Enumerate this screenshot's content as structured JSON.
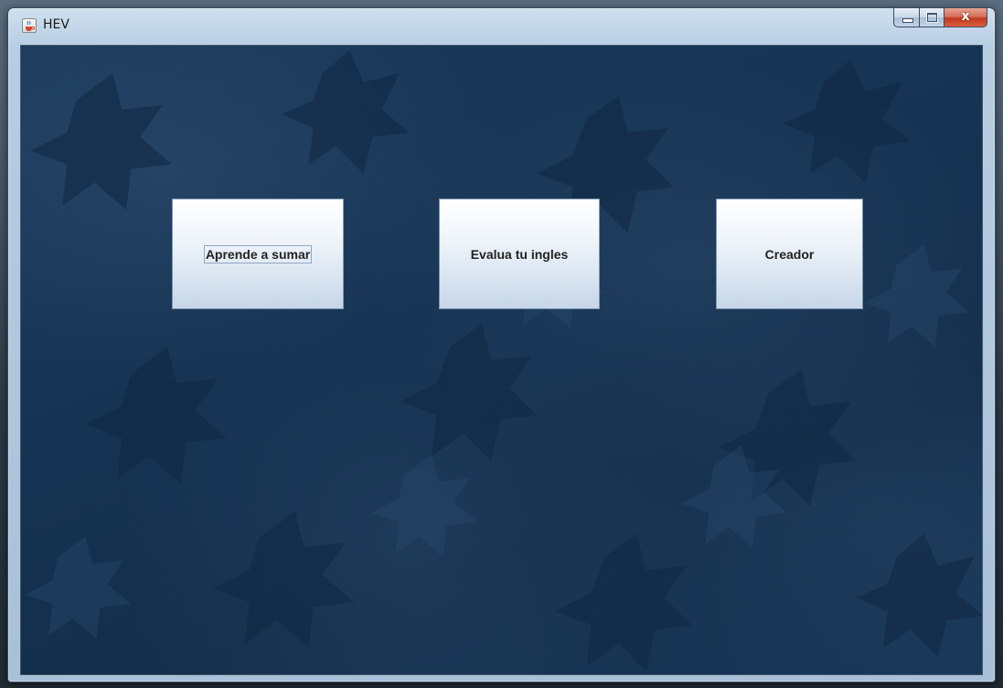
{
  "window": {
    "title": "HEV",
    "icon": "java-cup-icon",
    "controls": {
      "minimize": "minimize-icon",
      "maximize": "maximize-icon",
      "close_glyph": "x"
    }
  },
  "main": {
    "buttons": [
      {
        "label": "Aprende a sumar",
        "focused": true
      },
      {
        "label": "Evalua tu ingles",
        "focused": false
      },
      {
        "label": "Creador",
        "focused": false
      }
    ]
  },
  "colors": {
    "background": "#163353",
    "button_top": "#ffffff",
    "button_bottom": "#c6d6e8",
    "close_button": "#c2391c"
  }
}
